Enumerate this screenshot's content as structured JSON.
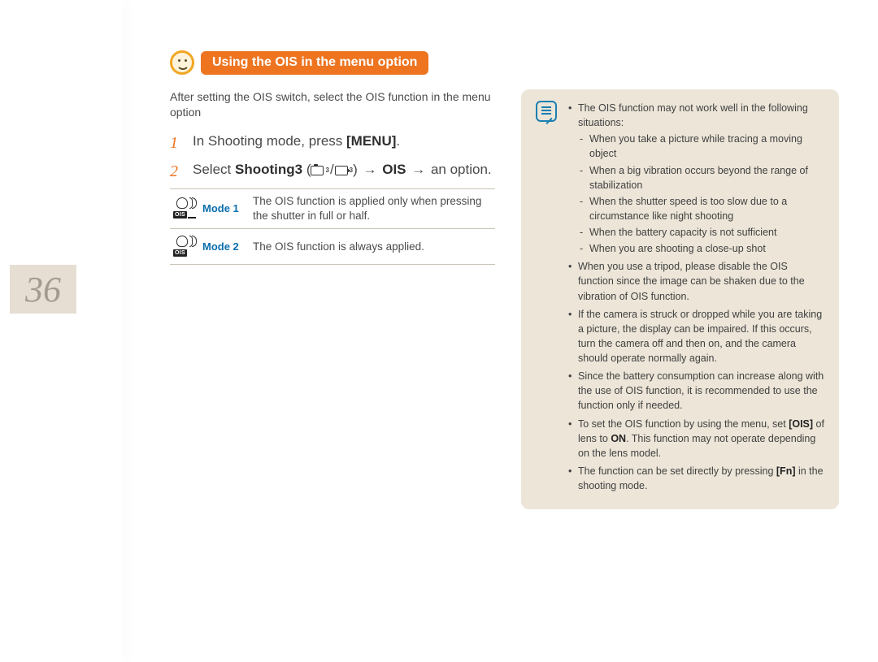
{
  "page_number": "36",
  "heading": "Using the OIS in the menu option",
  "intro": "After setting the OIS switch, select the OIS function in the menu option",
  "steps": [
    {
      "num": "1",
      "pre": "In Shooting mode, press ",
      "bold": "[MENU]",
      "post": "."
    },
    {
      "num": "2",
      "pre": "Select ",
      "bold1": "Shooting3",
      "mid": " (",
      "icon_sub": "3",
      "paren_close": ") ",
      "arrow": "→",
      "bold2": " OIS ",
      "arrow2": "→",
      "post": " an option."
    }
  ],
  "modes": [
    {
      "label": "Mode 1",
      "desc": "The OIS function is applied only when pressing the shutter in full or half."
    },
    {
      "label": "Mode 2",
      "desc": "The OIS function is always applied."
    }
  ],
  "notes": {
    "b1": {
      "lead": "The OIS function may not work well in the following situations:",
      "subs": [
        "When you take a picture while tracing a moving object",
        "When a big vibration occurs beyond the range of stabilization",
        "When the shutter speed is too slow due to a circumstance like night shooting",
        "When the battery capacity is not sufficient",
        "When you are shooting a close-up shot"
      ]
    },
    "b2": "When you use a tripod, please disable the OIS function since the image can be shaken due to the vibration of OIS function.",
    "b3": "If the camera is struck or dropped while you are taking a picture, the display can be impaired. If this occurs, turn the camera off and then on, and the camera should operate normally again.",
    "b4": "Since the battery consumption can increase along with the use of OIS function, it is recommended to use the function only if needed.",
    "b5_pre": "To set the OIS function by using the menu, set ",
    "b5_bold1": "[OIS]",
    "b5_mid": " of lens to ",
    "b5_bold2": "ON",
    "b5_post": ". This function may not operate depending on the lens model.",
    "b6_pre": "The function can be set directly by pressing ",
    "b6_bold": "[Fn]",
    "b6_post": " in the shooting mode."
  }
}
